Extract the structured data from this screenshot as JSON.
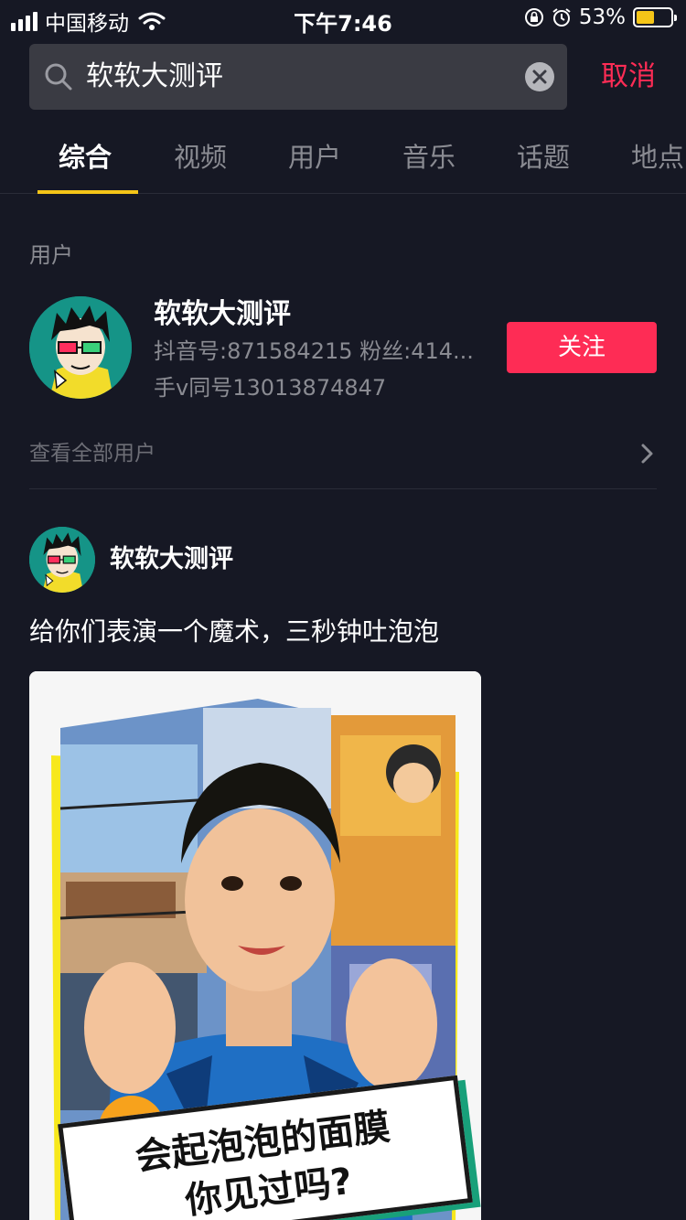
{
  "status_bar": {
    "carrier": "中国移动",
    "time": "下午7:46",
    "battery_pct": "53%",
    "battery_level": 0.53,
    "battery_color": "#f5c518",
    "icons": [
      "signal-icon",
      "wifi-icon",
      "rotation-lock-icon",
      "alarm-icon",
      "battery-icon"
    ]
  },
  "search": {
    "query": "软软大测评",
    "cancel_label": "取消",
    "accent": "#fe2c55"
  },
  "tabs": [
    {
      "label": "综合",
      "active": true
    },
    {
      "label": "视频",
      "active": false
    },
    {
      "label": "用户",
      "active": false
    },
    {
      "label": "音乐",
      "active": false
    },
    {
      "label": "话题",
      "active": false
    },
    {
      "label": "地点",
      "active": false
    }
  ],
  "users_section": {
    "label": "用户",
    "user": {
      "name": "软软大测评",
      "meta": "抖音号:871584215  粉丝:414...",
      "desc": "手v同号13013874847",
      "follow_label": "关注"
    },
    "see_all_label": "查看全部用户"
  },
  "post": {
    "author": "软软大测评",
    "caption": "给你们表演一个魔术，三秒钟吐泡泡",
    "thumbnail_caption_line1": "会起泡泡的面膜",
    "thumbnail_caption_line2": "你见过吗?"
  }
}
